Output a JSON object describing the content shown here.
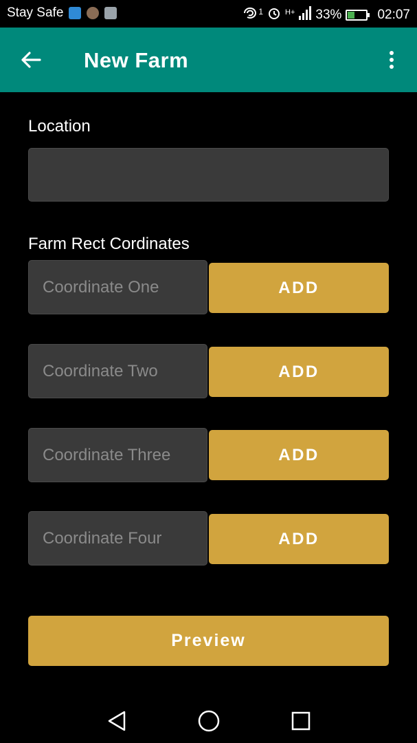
{
  "status_bar": {
    "carrier": "Stay Safe",
    "sim_badge": "1",
    "network": "H+",
    "battery": "33%",
    "time": "02:07",
    "icons": [
      "usb-icon",
      "avatar-icon",
      "image-icon",
      "hotspot-icon",
      "alarm-icon",
      "signal-icon",
      "battery-icon"
    ]
  },
  "app_bar": {
    "title": "New Farm",
    "background": "#00897b",
    "back_icon": "arrow-left-icon",
    "menu_icon": "more-vertical-icon"
  },
  "form": {
    "location_label": "Location",
    "location_value": "",
    "coords_label": "Farm Rect Cordinates",
    "coordinates": [
      {
        "placeholder": "Coordinate One",
        "button": "ADD"
      },
      {
        "placeholder": "Coordinate Two",
        "button": "ADD"
      },
      {
        "placeholder": "Coordinate Three",
        "button": "ADD"
      },
      {
        "placeholder": "Coordinate Four",
        "button": "ADD"
      }
    ],
    "preview_label": "Preview",
    "accent": "#d1a43e"
  },
  "nav_bar": {
    "icons": [
      "back-triangle-icon",
      "home-circle-icon",
      "recents-square-icon"
    ]
  }
}
